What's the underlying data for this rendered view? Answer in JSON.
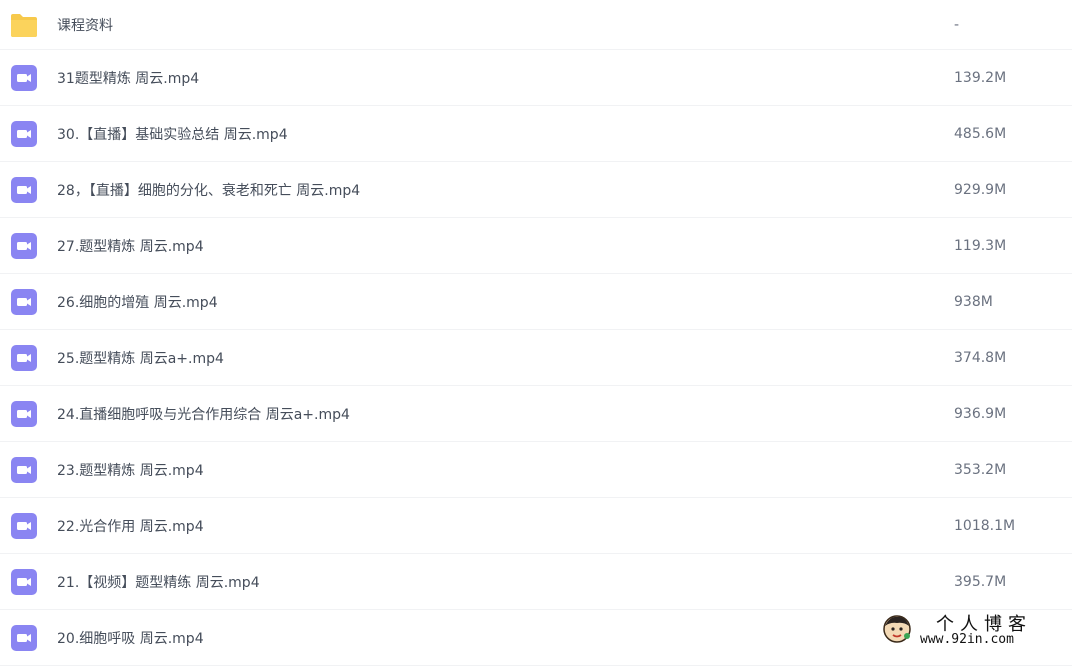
{
  "colors": {
    "folder": "#f7c94b",
    "video_icon": "#8a85f2",
    "row_divider": "#f1f2f4"
  },
  "files": [
    {
      "icon": "folder-icon",
      "name": "课程资料",
      "size": "-"
    },
    {
      "icon": "video-file-icon",
      "name": "31题型精炼 周云.mp4",
      "size": "139.2M"
    },
    {
      "icon": "video-file-icon",
      "name": "30.【直播】基础实验总结 周云.mp4",
      "size": "485.6M"
    },
    {
      "icon": "video-file-icon",
      "name": "28，【直播】细胞的分化、衰老和死亡 周云.mp4",
      "size": "929.9M"
    },
    {
      "icon": "video-file-icon",
      "name": "27.题型精炼 周云.mp4",
      "size": "119.3M"
    },
    {
      "icon": "video-file-icon",
      "name": "26.细胞的增殖 周云.mp4",
      "size": "938M"
    },
    {
      "icon": "video-file-icon",
      "name": "25.题型精炼 周云a+.mp4",
      "size": "374.8M"
    },
    {
      "icon": "video-file-icon",
      "name": "24.直播细胞呼吸与光合作用综合 周云a+.mp4",
      "size": "936.9M"
    },
    {
      "icon": "video-file-icon",
      "name": "23.题型精炼 周云.mp4",
      "size": "353.2M"
    },
    {
      "icon": "video-file-icon",
      "name": "22.光合作用 周云.mp4",
      "size": "1018.1M"
    },
    {
      "icon": "video-file-icon",
      "name": "21.【视频】题型精练 周云.mp4",
      "size": "395.7M"
    },
    {
      "icon": "video-file-icon",
      "name": "20.细胞呼吸 周云.mp4",
      "size": ""
    }
  ],
  "watermark": {
    "title": "个人博客",
    "url": "www.92in.com"
  }
}
